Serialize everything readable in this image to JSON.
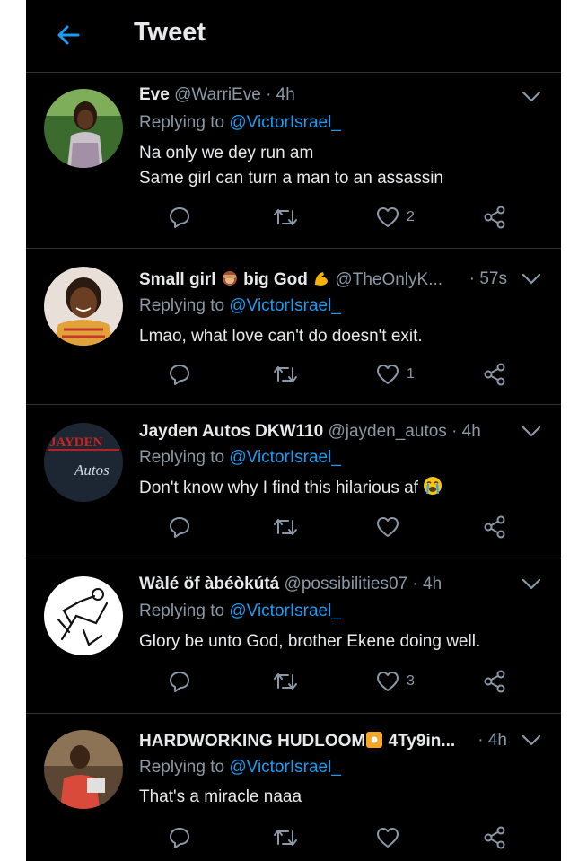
{
  "header": {
    "title": "Tweet"
  },
  "replying_to_label": "Replying to",
  "tweets": [
    {
      "name": "Eve",
      "handle": "@WarriEve",
      "time": "· 4h",
      "mention": "@VictorIsrael_",
      "lines": [
        "Na only we dey run am",
        "Same girl can turn a man to an assassin"
      ],
      "likes": "2"
    },
    {
      "name_a": "Small girl",
      "name_b": "big God",
      "handle": "@TheOnlyK...",
      "time": "· 57s",
      "mention": "@VictorIsrael_",
      "lines": [
        "Lmao, what love can't do doesn't exit."
      ],
      "likes": "1"
    },
    {
      "name": "Jayden Autos DKW110",
      "handle": "@jayden_autos",
      "time": "· 4h",
      "mention": "@VictorIsrael_",
      "lines": [
        "Don't know why I find this hilarious af"
      ],
      "likes": "",
      "avatar_text_a": "JAYDEN",
      "avatar_text_b": "Autos"
    },
    {
      "name": "Wàlé öf àbéòkútá",
      "handle": "@possibilities07",
      "time": "· 4h",
      "mention": "@VictorIsrael_",
      "lines": [
        "Glory be unto God, brother Ekene doing well."
      ],
      "likes": "3"
    },
    {
      "name": "HARDWORKING HUDLOOM",
      "handle": "4Ty9in...",
      "time": "· 4h",
      "mention": "@VictorIsrael_",
      "lines": [
        "That's a miracle naaa"
      ],
      "likes": ""
    }
  ],
  "icons": {
    "back": "arrow-left-icon",
    "more": "chevron-down-icon",
    "reply": "comment-icon",
    "retweet": "retweet-icon",
    "like": "heart-icon",
    "share": "share-icon"
  },
  "colors": {
    "background": "#000000",
    "accent": "#1d9bf0",
    "text": "#e7e9ea",
    "muted": "#8b98a5",
    "divider": "#2f3336"
  }
}
